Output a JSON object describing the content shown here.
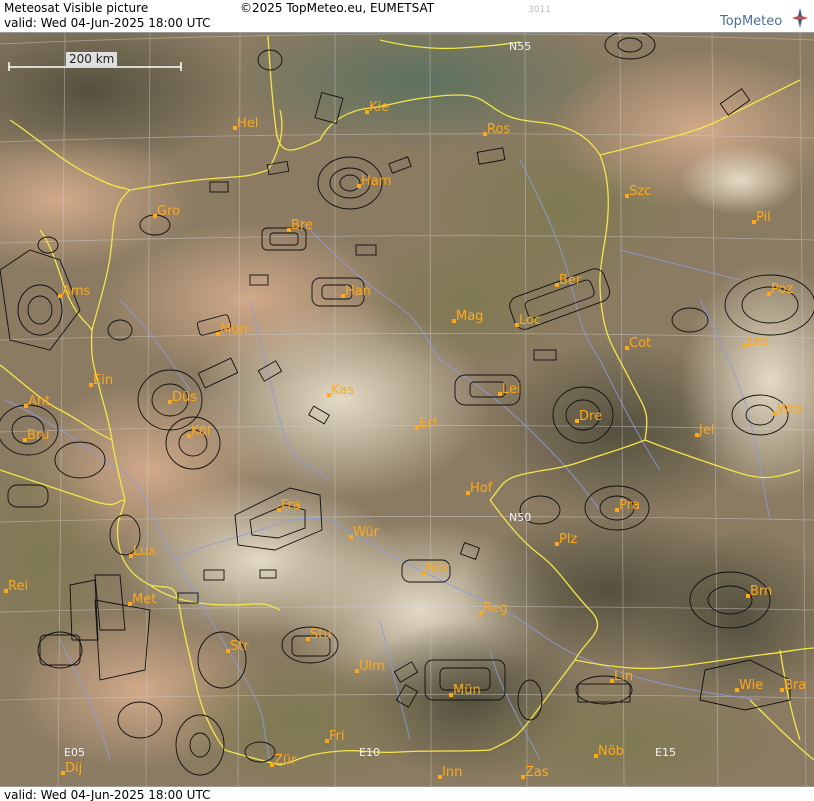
{
  "header": {
    "title": "Meteosat Visible picture",
    "valid": "valid:  Wed  04-Jun-2025  18:00 UTC",
    "copyright": "©2025 TopMeteo.eu, EUMETSAT",
    "code": "3011",
    "logo": "TopMeteo"
  },
  "footer": {
    "valid": "valid:  Wed  04-Jun-2025  18:00 UTC"
  },
  "scale": {
    "label": "200 km"
  },
  "grid_labels": [
    "N55",
    "N50",
    "E05",
    "E10",
    "E15"
  ],
  "cities": [
    "Hel",
    "Kie",
    "Ros",
    "Ham",
    "Szc",
    "Pil",
    "Gro",
    "Bre",
    "Ber",
    "Poz",
    "Ams",
    "Han",
    "Mag",
    "Loc",
    "Mün",
    "Cot",
    "Les",
    "Ein",
    "Lei",
    "Ant",
    "Düs",
    "Kas",
    "Dre",
    "Wro",
    "Bru",
    "Köl",
    "Erf",
    "Jel",
    "Hof",
    "Pra",
    "Fra",
    "Lux",
    "Wür",
    "Plz",
    "Nür",
    "Rei",
    "Met",
    "Reg",
    "Brn",
    "Stu",
    "Str",
    "Ulm",
    "Lin",
    "Mün",
    "Wie",
    "Bra",
    "Fri",
    "Zür",
    "Dij",
    "Inn",
    "Zas",
    "Nöb"
  ],
  "colors": {
    "city_label": "#ffa818",
    "city_dot": "#ffa818",
    "borders": "#f2e64a",
    "rivers": "#8e9ae0",
    "airspace": "#101010",
    "grid": "#cfcfcf"
  }
}
